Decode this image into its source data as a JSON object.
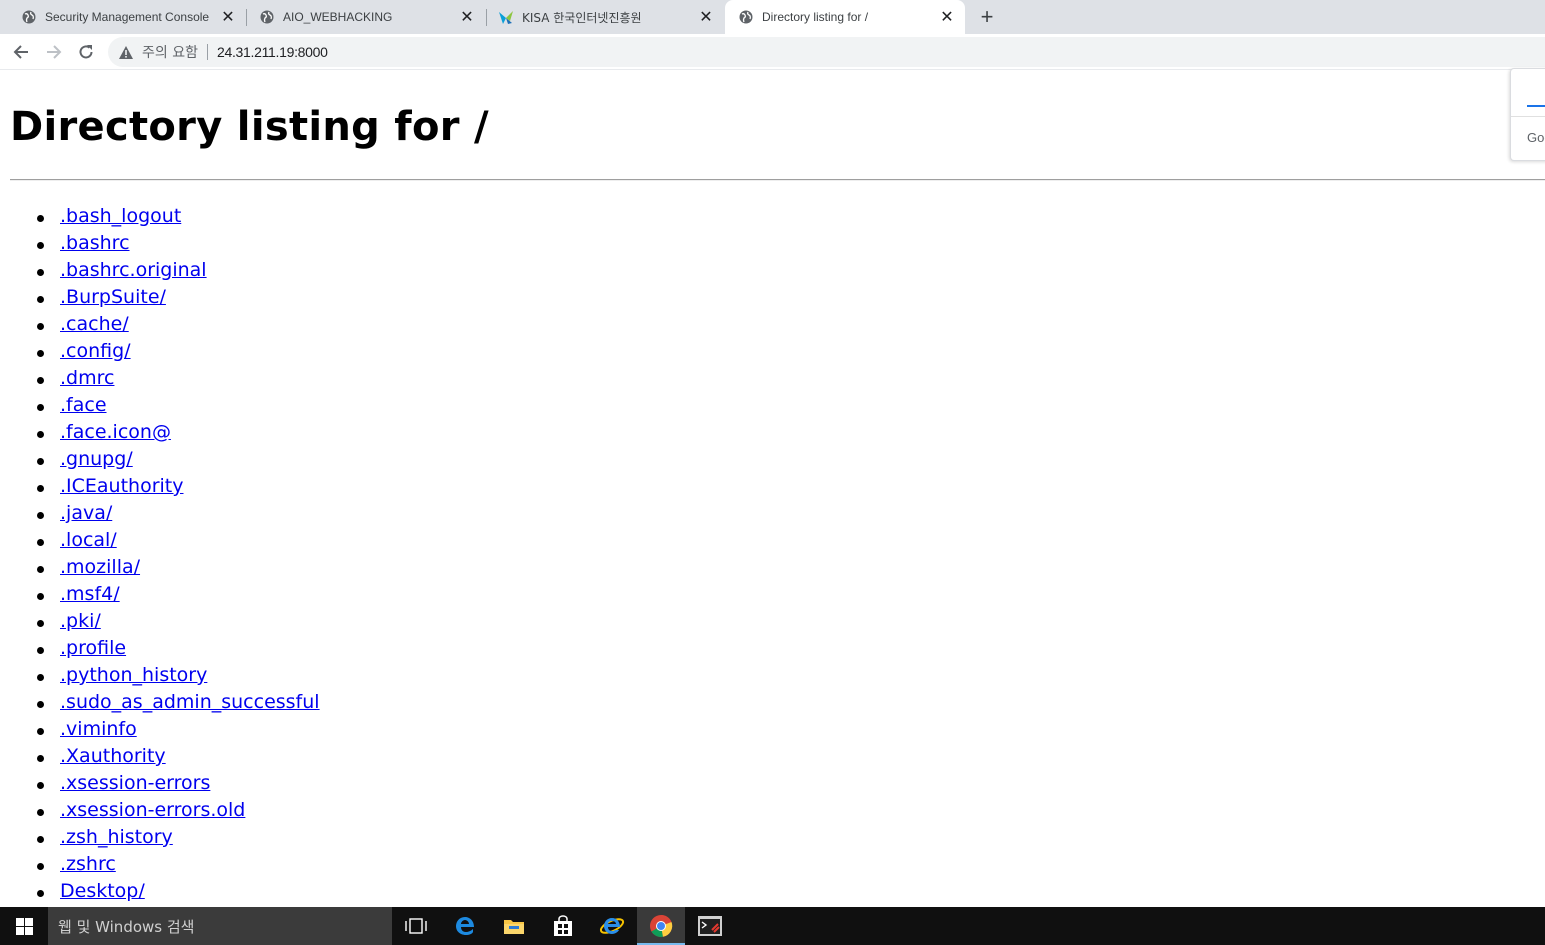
{
  "tabs": [
    {
      "title": "Security Management Console",
      "favicon": "globe-icon",
      "active": false
    },
    {
      "title": "AIO_WEBHACKING",
      "favicon": "globe-icon",
      "active": false
    },
    {
      "title": "KISA 한국인터넷진흥원",
      "favicon": "kisa-logo-icon",
      "active": false
    },
    {
      "title": "Directory listing for /",
      "favicon": "globe-icon",
      "active": true
    }
  ],
  "toolbar": {
    "security_label": "주의 요함",
    "url": "24.31.211.19:8000"
  },
  "page": {
    "heading": "Directory listing for /",
    "items": [
      ".bash_logout",
      ".bashrc",
      ".bashrc.original",
      ".BurpSuite/",
      ".cache/",
      ".config/",
      ".dmrc",
      ".face",
      ".face.icon@",
      ".gnupg/",
      ".ICEauthority",
      ".java/",
      ".local/",
      ".mozilla/",
      ".msf4/",
      ".pki/",
      ".profile",
      ".python_history",
      ".sudo_as_admin_successful",
      ".viminfo",
      ".Xauthority",
      ".xsession-errors",
      ".xsession-errors.old",
      ".zsh_history",
      ".zshrc",
      "Desktop/"
    ]
  },
  "side_panel": {
    "text": "Goo"
  },
  "taskbar": {
    "search_placeholder": "웹 및 Windows 검색",
    "apps": [
      "task-view-icon",
      "edge-icon",
      "file-explorer-icon",
      "store-icon",
      "internet-explorer-icon",
      "chrome-icon",
      "terminal-icon"
    ],
    "active_app": "chrome-icon"
  }
}
